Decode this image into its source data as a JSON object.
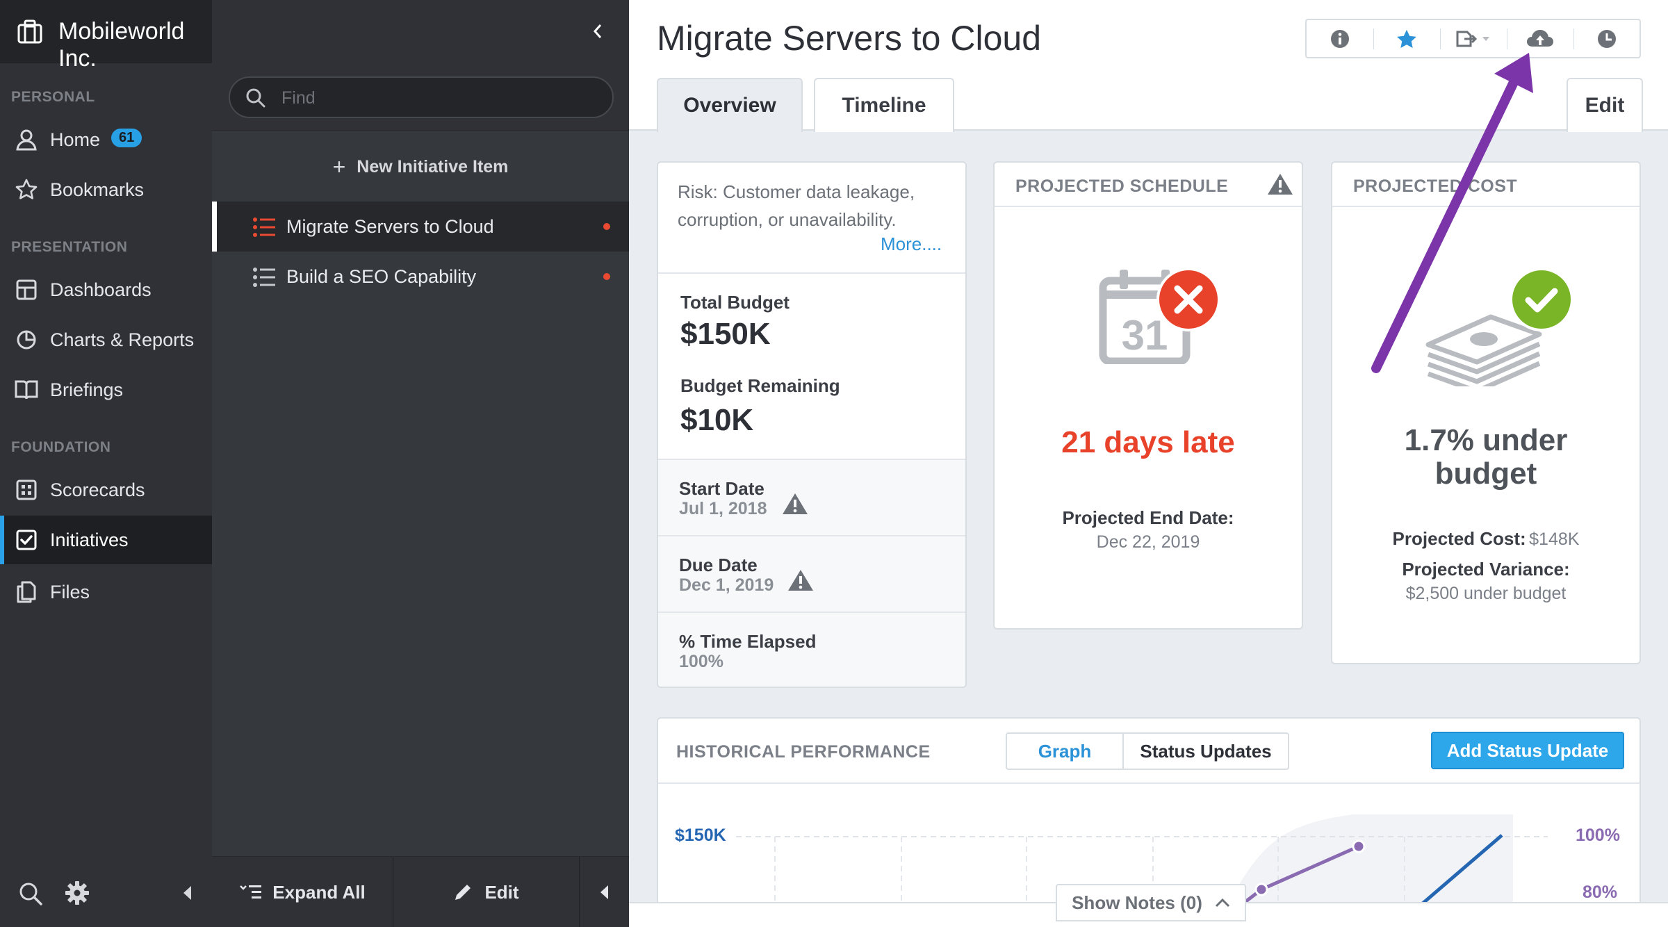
{
  "app": {
    "org_name": "Mobileworld Inc.",
    "accent": "#2aa1e8"
  },
  "nav": {
    "sections": [
      {
        "label": "PERSONAL"
      },
      {
        "label": "PRESENTATION"
      },
      {
        "label": "FOUNDATION"
      }
    ],
    "items": [
      {
        "label": "Home",
        "icon": "user-icon",
        "badge": "61"
      },
      {
        "label": "Bookmarks",
        "icon": "star-icon"
      },
      {
        "label": "Dashboards",
        "icon": "dashboard-icon"
      },
      {
        "label": "Charts & Reports",
        "icon": "pie-chart-icon"
      },
      {
        "label": "Briefings",
        "icon": "book-icon"
      },
      {
        "label": "Scorecards",
        "icon": "scorecard-icon"
      },
      {
        "label": "Initiatives",
        "icon": "checkbox-icon",
        "active": true
      },
      {
        "label": "Files",
        "icon": "files-icon"
      }
    ]
  },
  "panel": {
    "search_placeholder": "Find",
    "new_item_label": "New Initiative Item",
    "items": [
      {
        "label": "Migrate Servers to Cloud",
        "active": true,
        "status_color": "#ea4a32"
      },
      {
        "label": "Build a SEO Capability",
        "active": false,
        "status_color": "#ea4a32"
      }
    ],
    "expand_all_label": "Expand All",
    "edit_label": "Edit"
  },
  "main": {
    "title": "Migrate Servers to Cloud",
    "tabs": [
      {
        "label": "Overview",
        "active": true
      },
      {
        "label": "Timeline",
        "active": false
      }
    ],
    "edit_label": "Edit",
    "toolbar_icons": [
      "info-icon",
      "star-icon",
      "export-icon",
      "cloud-upload-icon",
      "clock-icon"
    ],
    "summary": {
      "risk": "Risk: Customer data leakage, corruption, or unavailability.",
      "more": "More....",
      "total_budget_label": "Total Budget",
      "total_budget": "$150K",
      "budget_remaining_label": "Budget Remaining",
      "budget_remaining": "$10K",
      "start_date_label": "Start Date",
      "start_date": "Jul 1, 2018",
      "due_date_label": "Due Date",
      "due_date": "Dec 1, 2019",
      "time_elapsed_label": "% Time Elapsed",
      "time_elapsed": "100%"
    },
    "schedule": {
      "title": "PROJECTED SCHEDULE",
      "calendar_day": "31",
      "status": "21 days late",
      "end_date_label": "Projected End Date:",
      "end_date": "Dec 22, 2019",
      "status_color": "#e8422b"
    },
    "cost": {
      "title": "PROJECTED COST",
      "status_line1": "1.7% under",
      "status_line2": "budget",
      "cost_label": "Projected Cost:",
      "cost_value": "$148K",
      "variance_label": "Projected Variance:",
      "variance_value": "$2,500 under budget",
      "status_color": "#7ab527"
    },
    "history": {
      "title": "HISTORICAL PERFORMANCE",
      "graph_label": "Graph",
      "status_updates_label": "Status Updates",
      "add_status_label": "Add Status Update",
      "left_axis_top": "$150K",
      "right_axis_top": "100%",
      "right_axis_second": "80%",
      "show_notes_label": "Show Notes (0)"
    }
  }
}
